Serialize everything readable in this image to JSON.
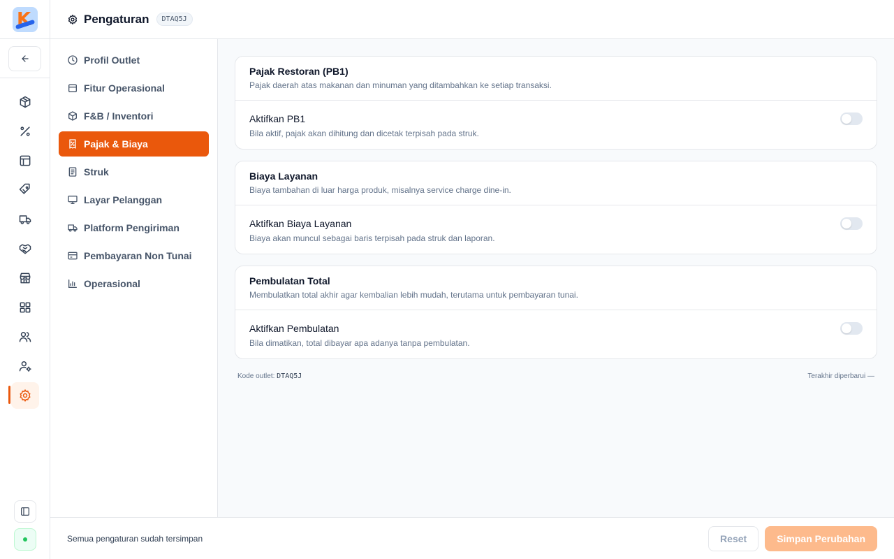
{
  "app": {
    "logo_letter": "K"
  },
  "header": {
    "title": "Pengaturan",
    "outlet_code": "DTAQ5J"
  },
  "rail": {
    "items": [
      {
        "icon": "box-icon"
      },
      {
        "icon": "percent-icon"
      },
      {
        "icon": "layout-icon"
      },
      {
        "icon": "tag-icon"
      },
      {
        "icon": "truck-icon"
      },
      {
        "icon": "handshake-icon"
      },
      {
        "icon": "store-icon"
      },
      {
        "icon": "grid-icon"
      },
      {
        "icon": "users-icon"
      },
      {
        "icon": "user-settings-icon"
      },
      {
        "icon": "gear-icon",
        "active": true
      }
    ]
  },
  "settings_nav": {
    "items": [
      {
        "label": "Profil Outlet",
        "icon": "clock-icon"
      },
      {
        "label": "Fitur Operasional",
        "icon": "archive-icon"
      },
      {
        "label": "F&B / Inventori",
        "icon": "box-icon"
      },
      {
        "label": "Pajak & Biaya",
        "icon": "receipt-percent-icon",
        "active": true
      },
      {
        "label": "Struk",
        "icon": "receipt-icon"
      },
      {
        "label": "Layar Pelanggan",
        "icon": "monitor-icon"
      },
      {
        "label": "Platform Pengiriman",
        "icon": "truck-icon"
      },
      {
        "label": "Pembayaran Non Tunai",
        "icon": "credit-card-icon"
      },
      {
        "label": "Operasional",
        "icon": "bar-chart-icon"
      }
    ]
  },
  "cards": [
    {
      "title": "Pajak Restoran (PB1)",
      "description": "Pajak daerah atas makanan dan minuman yang ditambahkan ke setiap transaksi.",
      "row_title": "Aktifkan PB1",
      "row_description": "Bila aktif, pajak akan dihitung dan dicetak terpisah pada struk.",
      "enabled": false
    },
    {
      "title": "Biaya Layanan",
      "description": "Biaya tambahan di luar harga produk, misalnya service charge dine-in.",
      "row_title": "Aktifkan Biaya Layanan",
      "row_description": "Biaya akan muncul sebagai baris terpisah pada struk dan laporan.",
      "enabled": false
    },
    {
      "title": "Pembulatan Total",
      "description": "Membulatkan total akhir agar kembalian lebih mudah, terutama untuk pembayaran tunai.",
      "row_title": "Aktifkan Pembulatan",
      "row_description": "Bila dimatikan, total dibayar apa adanya tanpa pembulatan.",
      "enabled": false
    }
  ],
  "meta": {
    "code_label": "Kode outlet:",
    "code_value": "DTAQ5J",
    "last_updated": "Terakhir diperbarui —"
  },
  "footer": {
    "status": "Semua pengaturan sudah tersimpan",
    "reset_label": "Reset",
    "save_label": "Simpan Perubahan"
  },
  "colors": {
    "accent": "#ea580c",
    "accent_disabled": "#fdba8c",
    "toggle_off": "#e2e8f0"
  }
}
